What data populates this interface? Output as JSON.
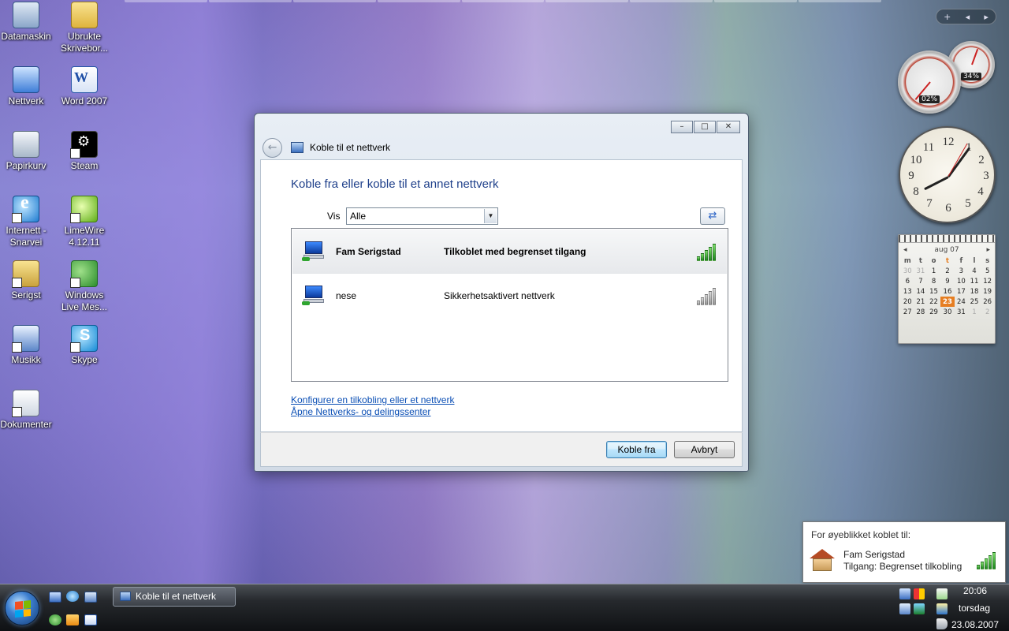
{
  "desktop": {
    "icons": [
      {
        "label": "Datamaskin"
      },
      {
        "label": "Ubrukte Skrivebor..."
      },
      {
        "label": "Nettverk"
      },
      {
        "label": "Word 2007"
      },
      {
        "label": "Papirkurv"
      },
      {
        "label": "Steam"
      },
      {
        "label": "Internett - Snarvei"
      },
      {
        "label": "LimeWire 4.12.11"
      },
      {
        "label": "Serigst"
      },
      {
        "label": "Windows Live Mes..."
      },
      {
        "label": "Musikk"
      },
      {
        "label": "Skype"
      },
      {
        "label": "Dokumenter"
      }
    ]
  },
  "dialog": {
    "title": "Koble til et nettverk",
    "heading": "Koble fra eller koble til et annet nettverk",
    "filter_label": "Vis",
    "filter_value": "Alle",
    "networks": [
      {
        "name": "Fam Serigstad",
        "status": "Tilkoblet med begrenset tilgang",
        "signal": 5,
        "selected": true
      },
      {
        "name": "nese",
        "status": "Sikkerhetsaktivert nettverk",
        "signal": 0,
        "selected": false
      }
    ],
    "links": {
      "configure": "Konfigurer en tilkobling eller et nettverk",
      "network_center": "Åpne Nettverks- og delingssenter"
    },
    "buttons": {
      "disconnect": "Koble fra",
      "cancel": "Avbryt"
    }
  },
  "gadgets": {
    "cpu_meter": {
      "cpu": "02%",
      "memory": "34%"
    },
    "clock": {
      "numbers": [
        "12",
        "1",
        "2",
        "3",
        "4",
        "5",
        "6",
        "7",
        "8",
        "9",
        "10",
        "11"
      ],
      "time": "20:06"
    },
    "calendar": {
      "month": "aug 07",
      "weekdays": [
        "m",
        "t",
        "o",
        "t",
        "f",
        "l",
        "s"
      ],
      "weeks": [
        [
          "30",
          "31",
          "1",
          "2",
          "3",
          "4",
          "5"
        ],
        [
          "6",
          "7",
          "8",
          "9",
          "10",
          "11",
          "12"
        ],
        [
          "13",
          "14",
          "15",
          "16",
          "17",
          "18",
          "19"
        ],
        [
          "20",
          "21",
          "22",
          "23",
          "24",
          "25",
          "26"
        ],
        [
          "27",
          "28",
          "29",
          "30",
          "31",
          "1",
          "2"
        ]
      ],
      "today": "23"
    }
  },
  "notification": {
    "header": "For øyeblikket koblet til:",
    "network": "Fam Serigstad",
    "access": "Tilgang:  Begrenset tilkobling",
    "signal": 5
  },
  "taskbar": {
    "window_button": "Koble til et nettverk",
    "time": "20:06",
    "day": "torsdag",
    "date": "23.08.2007"
  },
  "colors": {
    "accent_link": "#0b4fb5",
    "heading": "#1e3f8a",
    "signal_on": "#2fa52f",
    "today": "#e67e22"
  }
}
